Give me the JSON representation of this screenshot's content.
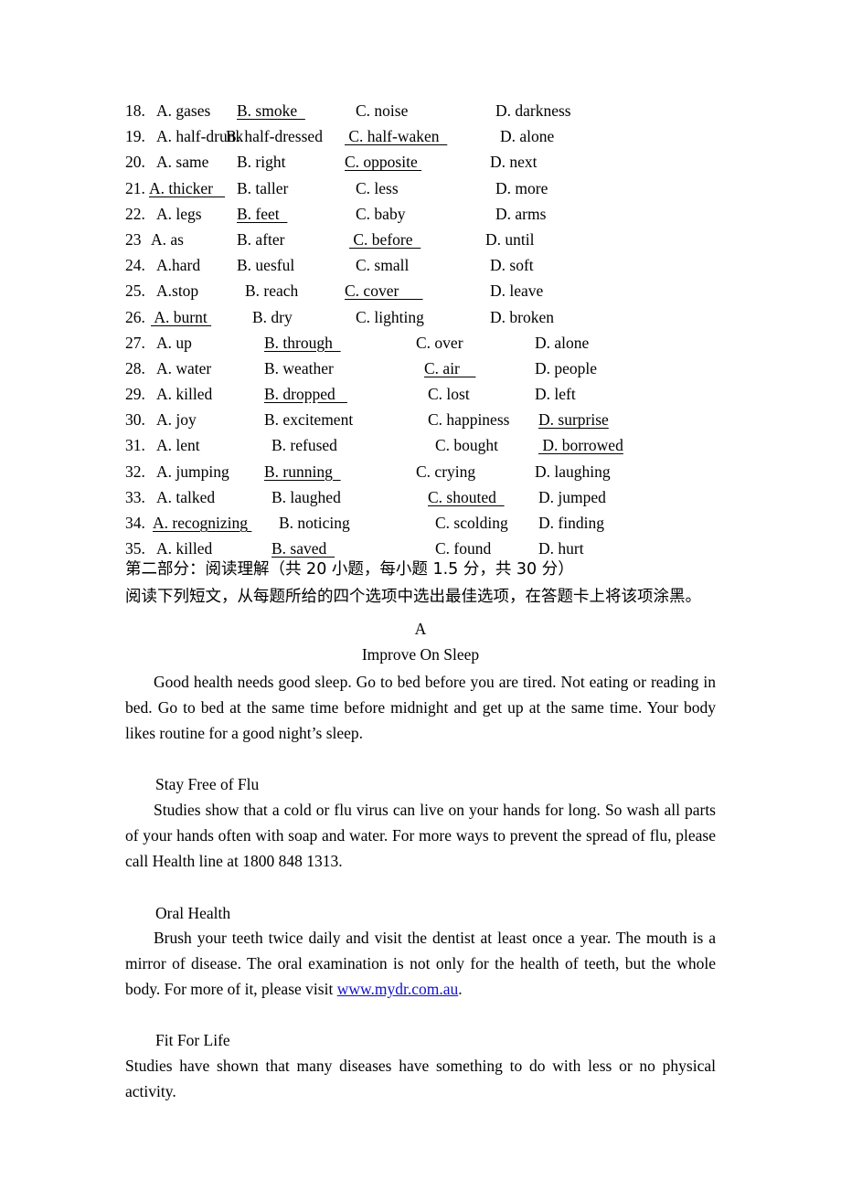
{
  "document": {
    "type": "exam-paper",
    "link_color": "#1010cf"
  },
  "mcq": {
    "rows": [
      {
        "num": "18.",
        "a": "A. gases",
        "b": "B. smoke  ",
        "c": "C. noise",
        "d": "D. darkness",
        "underlined": "b",
        "x": {
          "a": 34,
          "b": 122,
          "c": 252,
          "d": 405
        }
      },
      {
        "num": "19.",
        "a": "A. half-drunk",
        "b": "B. half-dressed",
        "c": " C. half-waken  ",
        "d": "D. alone",
        "underlined": "c",
        "x": {
          "a": 34,
          "b": 110,
          "c": 240,
          "d": 410
        }
      },
      {
        "num": "20.",
        "a": "A. same",
        "b": "B. right",
        "c": "C. opposite ",
        "d": "D. next",
        "underlined": "c",
        "x": {
          "a": 34,
          "b": 122,
          "c": 240,
          "d": 399
        }
      },
      {
        "num": "21.",
        "a": "A. thicker   ",
        "b": "B. taller",
        "c": "C. less",
        "d": "D. more",
        "underlined": "a",
        "x": {
          "a": 26,
          "b": 122,
          "c": 252,
          "d": 405
        }
      },
      {
        "num": "22.",
        "a": "A. legs",
        "b": "B. feet  ",
        "c": "C. baby",
        "d": "D. arms",
        "underlined": "b",
        "x": {
          "a": 34,
          "b": 122,
          "c": 252,
          "d": 405
        }
      },
      {
        "num": "23",
        "a": "A. as",
        "b": "B. after",
        "c": " C. before  ",
        "d": "D. until",
        "underlined": "c",
        "x": {
          "a": 28,
          "b": 122,
          "c": 245,
          "d": 394
        }
      },
      {
        "num": "24.",
        "a": "A.hard",
        "b": "B. uesful",
        "c": "C. small",
        "d": "D. soft",
        "underlined": "",
        "x": {
          "a": 34,
          "b": 122,
          "c": 252,
          "d": 399
        }
      },
      {
        "num": "25.",
        "a": "A.stop",
        "b": "B. reach",
        "c": "C. cover      ",
        "d": "D. leave",
        "underlined": "c",
        "x": {
          "a": 34,
          "b": 131,
          "c": 240,
          "d": 399
        }
      },
      {
        "num": "26.",
        "a": " A. burnt ",
        "b": "B. dry",
        "c": "C. lighting",
        "d": "D. broken",
        "underlined": "a",
        "x": {
          "a": 28,
          "b": 139,
          "c": 252,
          "d": 399
        }
      },
      {
        "num": "27.",
        "a": "A. up",
        "b": "B. through  ",
        "c": "C. over",
        "d": "D. alone",
        "underlined": "b",
        "x": {
          "a": 34,
          "b": 152,
          "c": 318,
          "d": 448
        }
      },
      {
        "num": "28.",
        "a": "A. water",
        "b": "B. weather",
        "c": "C. air    ",
        "d": "D. people",
        "underlined": "c",
        "x": {
          "a": 34,
          "b": 152,
          "c": 327,
          "d": 448
        }
      },
      {
        "num": "29.",
        "a": "A. killed",
        "b": "B. dropped   ",
        "c": "C. lost",
        "d": "D. left",
        "underlined": "b",
        "x": {
          "a": 34,
          "b": 152,
          "c": 331,
          "d": 448
        }
      },
      {
        "num": "30.",
        "a": "A. joy",
        "b": "B. excitement",
        "c": "C. happiness",
        "d": "D. surprise",
        "underlined": "d",
        "x": {
          "a": 34,
          "b": 152,
          "c": 331,
          "d": 452
        }
      },
      {
        "num": "31.",
        "a": "A. lent",
        "b": "B. refused",
        "c": "C. bought",
        "d": " D. borrowed",
        "underlined": "d",
        "x": {
          "a": 34,
          "b": 160,
          "c": 339,
          "d": 452
        }
      },
      {
        "num": "32.",
        "a": "A. jumping",
        "b": "B. running  ",
        "c": "C. crying",
        "d": "D. laughing",
        "underlined": "b",
        "x": {
          "a": 34,
          "b": 152,
          "c": 318,
          "d": 448
        }
      },
      {
        "num": "33.",
        "a": "A. talked",
        "b": "B. laughed",
        "c": "C. shouted  ",
        "d": "D. jumped",
        "underlined": "c",
        "x": {
          "a": 34,
          "b": 160,
          "c": 331,
          "d": 452
        }
      },
      {
        "num": "34.",
        "a": "A. recognizing ",
        "b": "B. noticing",
        "c": "C. scolding",
        "d": "D. finding",
        "underlined": "a",
        "x": {
          "a": 30,
          "b": 168,
          "c": 339,
          "d": 452
        }
      },
      {
        "num": "35.",
        "a": "A. killed",
        "b": "B. saved  ",
        "c": "C. found",
        "d": "D. hurt",
        "underlined": "b",
        "x": {
          "a": 34,
          "b": 160,
          "c": 339,
          "d": 452
        }
      }
    ]
  },
  "section": {
    "heading": "第二部分：阅读理解（共 20 小题，每小题 1.5 分，共 30 分）",
    "instruction": "阅读下列短文，从每题所给的四个选项中选出最佳选项，在答题卡上将该项涂黑。"
  },
  "passage": {
    "letter": "A",
    "title": "Improve On Sleep",
    "sleep_text": "Good health needs good sleep.    Go to bed before you are tired.    Not eating or reading in bed. Go to bed at the same time before midnight and get up at the same time.    Your body likes routine for a good night’s sleep.",
    "flu_heading": "Stay Free of Flu",
    "flu_text": "Studies show that a cold or flu virus can live on your hands for long.    So wash all parts of your hands often with soap and water.    For more ways to prevent the spread of flu, please call Health line at 1800 848 1313.",
    "oral_heading": "Oral Health",
    "oral_text_before": "Brush your teeth twice daily and visit the dentist at least once a year.    The mouth is a mirror of disease.    The oral examination is not only for the health of teeth, but the whole body.    For more of it, please visit ",
    "oral_link": "www.mydr.com.au",
    "oral_text_after": ".",
    "fit_heading": "Fit For Life",
    "fit_text": "Studies have shown that many diseases have something to do with less or no physical activity."
  }
}
